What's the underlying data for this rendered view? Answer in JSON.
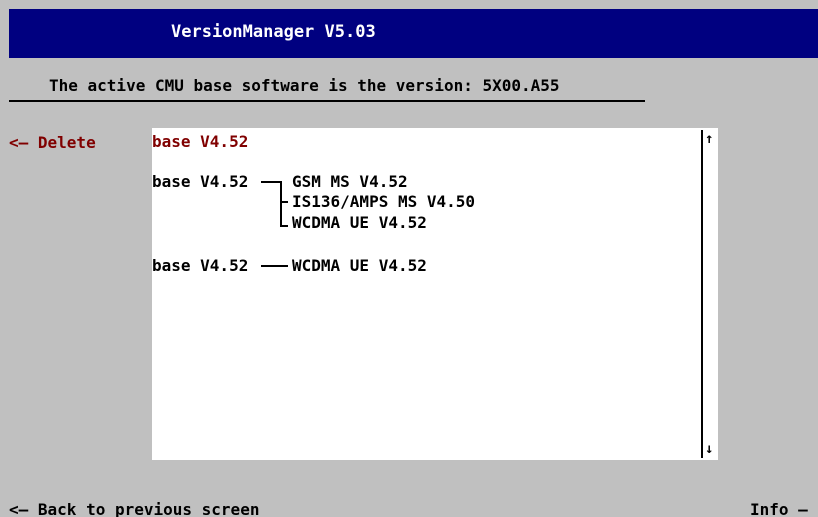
{
  "window": {
    "title": "VersionManager V5.03"
  },
  "status": {
    "text": "The active CMU base software is the version: 5X00.A55"
  },
  "softkeys": {
    "delete": "<— Delete",
    "back": "<— Back to previous screen",
    "info": "Info —"
  },
  "versions": {
    "selected": "base V4.52",
    "group1": {
      "base": "base V4.52",
      "options": [
        "GSM MS V4.52",
        "IS136/AMPS MS V4.50",
        "WCDMA UE V4.52"
      ]
    },
    "group2": {
      "base": "base V4.52",
      "options": [
        "WCDMA UE V4.52"
      ]
    }
  },
  "scrollbar": {
    "up_arrow": "↑",
    "down_arrow": "↓"
  },
  "colors": {
    "title_bar": "#000080",
    "background": "#c0c0c0",
    "panel": "#ffffff",
    "selected_text": "#800000"
  }
}
